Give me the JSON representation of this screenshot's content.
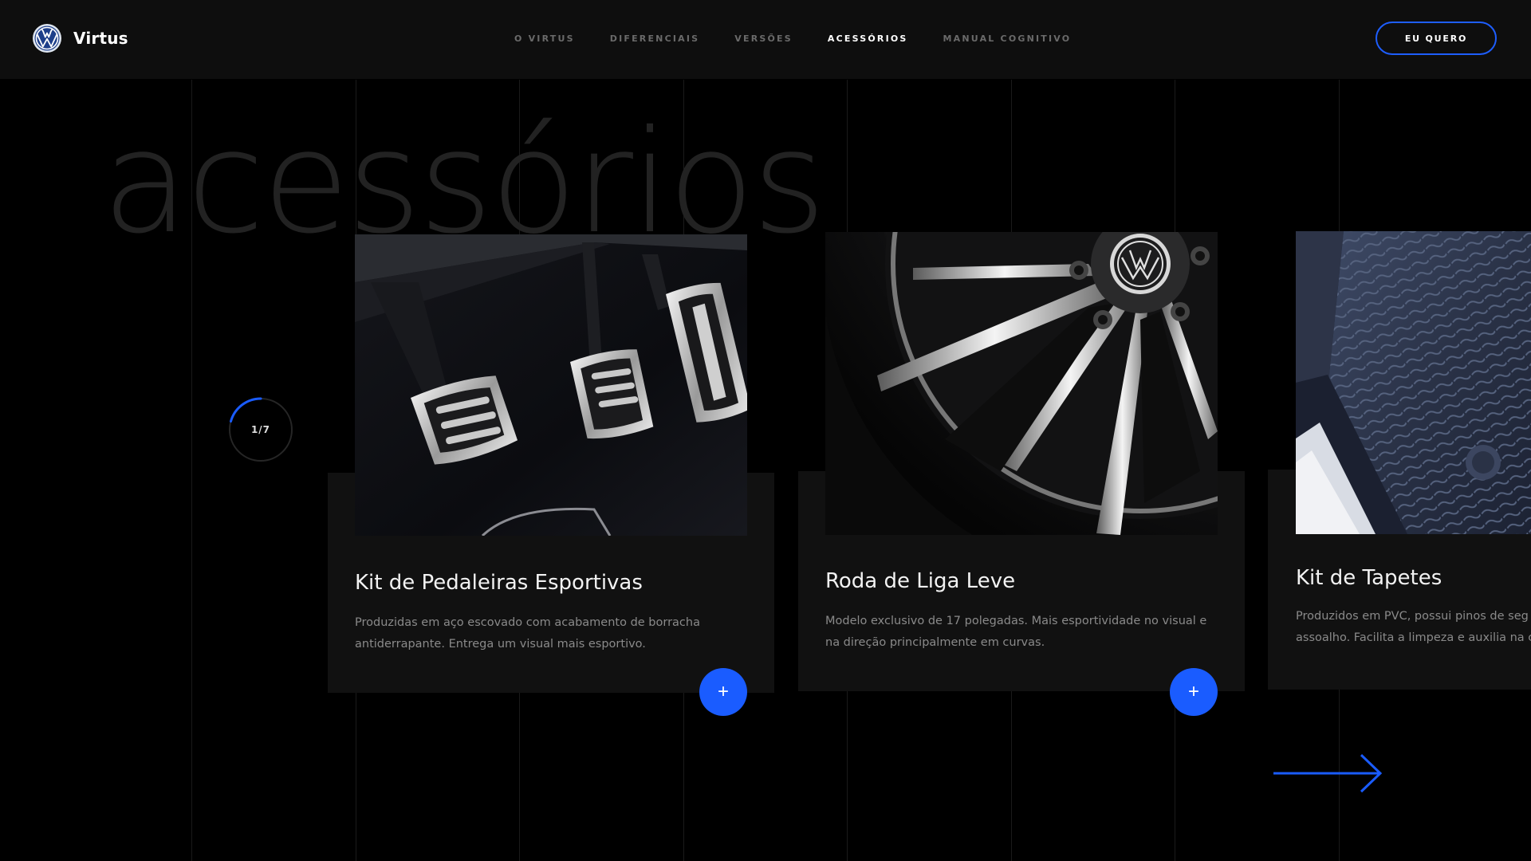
{
  "header": {
    "brand": "Virtus",
    "logo_icon": "vw-logo-icon",
    "nav": [
      {
        "label": "O VIRTUS",
        "active": false
      },
      {
        "label": "DIFERENCIAIS",
        "active": false
      },
      {
        "label": "VERSÕES",
        "active": false
      },
      {
        "label": "ACESSÓRIOS",
        "active": true
      },
      {
        "label": "MANUAL COGNITIVO",
        "active": false
      }
    ],
    "cta_label": "EU QUERO"
  },
  "section_title": "acessórios",
  "counter": {
    "current": 1,
    "total": 7,
    "label": "1/7"
  },
  "cards": [
    {
      "title": "Kit de Pedaleiras Esportivas",
      "desc_line1": "Produzidas em aço escovado com acabamento de borracha",
      "desc_line2": "antiderrapante. Entrega um visual mais esportivo.",
      "button": "+",
      "image": "pedals-image"
    },
    {
      "title": "Roda de Liga Leve",
      "desc_line1": "Modelo exclusivo de 17 polegadas. Mais esportividade no visual e",
      "desc_line2": "na direção principalmente em curvas.",
      "button": "+",
      "image": "alloy-wheel-image"
    },
    {
      "title": "Kit de Tapetes",
      "desc_line1": "Produzidos em PVC, possui pinos de seg",
      "desc_line2": "assoalho. Facilita a limpeza e auxilia na c",
      "image": "floor-mats-image"
    }
  ],
  "next_icon": "arrow-right-icon",
  "colors": {
    "accent": "#1a5cff",
    "background": "#000000",
    "card": "#111111",
    "header": "#0e0e0e"
  }
}
